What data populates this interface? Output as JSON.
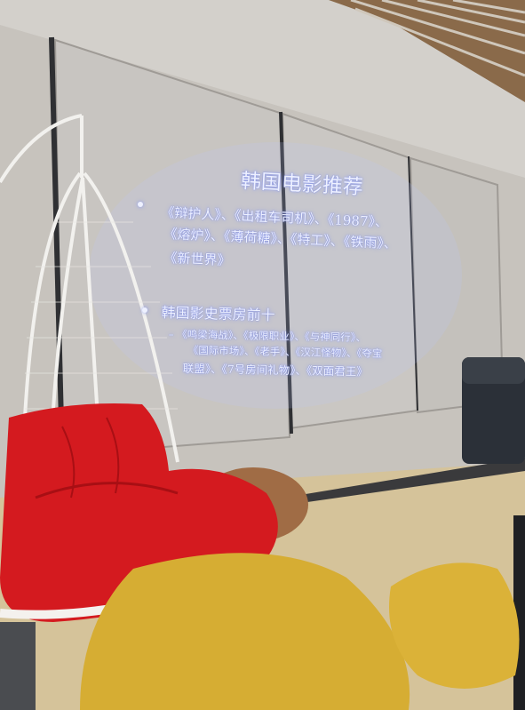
{
  "slide": {
    "title": "韩国电影推荐",
    "bullets": [
      {
        "lines": [
          "《辩护人》、《出租车司机》、《1987》、",
          "《熔炉》、《薄荷糖》、《特工》、《铁雨》、",
          "《新世界》"
        ]
      },
      {
        "text": "韩国影史票房前十",
        "sub_lines": [
          "– 《鸣梁海战》、《极限职业》、《与神同行》、",
          "《国际市场》、《老手》、《汉江怪物》、《夺宝",
          "联盟》、《7号房间礼物》、《双面君王》"
        ]
      }
    ]
  },
  "colors": {
    "screen": "#c9c6c2",
    "projection_text": "#eef1ff",
    "cushion": "#d9171d",
    "beanbag": "#dcb236",
    "floor": "#d8c7a0"
  }
}
